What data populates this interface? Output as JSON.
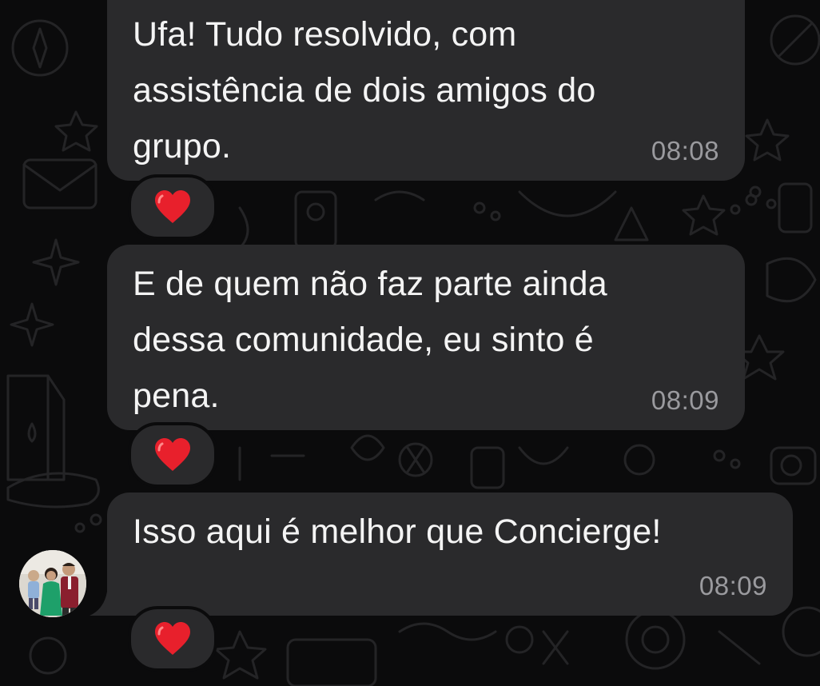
{
  "chat": {
    "messages": [
      {
        "text": "Ufa! Tudo resolvido, com\nassistência de dois amigos do\ngrupo.",
        "time": "08:08",
        "reaction": "heart-icon"
      },
      {
        "text": "E de quem não faz parte ainda\ndessa comunidade, eu sinto é\npena.",
        "time": "08:09",
        "reaction": "heart-icon"
      },
      {
        "text": "Isso aqui é melhor que Concierge!",
        "time": "08:09",
        "reaction": "heart-icon"
      }
    ]
  },
  "colors": {
    "background": "#0b0b0c",
    "bubble": "#2a2a2c",
    "text": "#f4f4f4",
    "timestamp": "#9a9a9e",
    "heart": "#e8202c"
  },
  "icons": {
    "avatar": "sender-avatar-photo",
    "wallpaper": "doodle-pattern"
  }
}
